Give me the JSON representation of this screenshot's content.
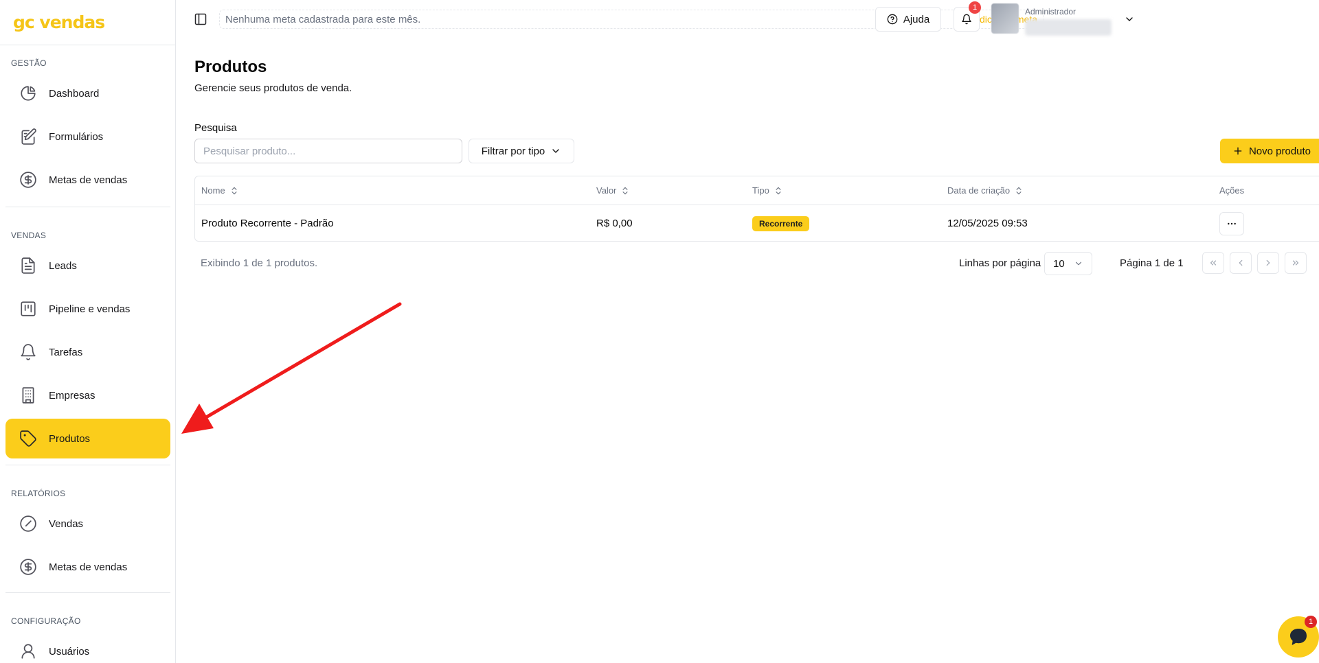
{
  "brand": {
    "logo_text": "gc vendas",
    "accent": "#fbcd1b"
  },
  "sidebar": {
    "groups": [
      {
        "title": "GESTÃO",
        "items": [
          {
            "label": "Dashboard",
            "icon": "pie-chart-icon"
          },
          {
            "label": "Formulários",
            "icon": "form-edit-icon"
          },
          {
            "label": "Metas de vendas",
            "icon": "dollar-circle-icon"
          }
        ]
      },
      {
        "title": "VENDAS",
        "items": [
          {
            "label": "Leads",
            "icon": "document-icon"
          },
          {
            "label": "Pipeline e vendas",
            "icon": "kanban-icon"
          },
          {
            "label": "Tarefas",
            "icon": "bell-icon"
          },
          {
            "label": "Empresas",
            "icon": "building-icon"
          },
          {
            "label": "Produtos",
            "icon": "tag-icon",
            "active": true
          }
        ]
      },
      {
        "title": "RELATÓRIOS",
        "items": [
          {
            "label": "Vendas",
            "icon": "gauge-icon"
          },
          {
            "label": "Metas de vendas",
            "icon": "dollar-circle-icon"
          }
        ]
      },
      {
        "title": "CONFIGURAÇÃO",
        "items": [
          {
            "label": "Usuários",
            "icon": "user-icon"
          }
        ]
      }
    ]
  },
  "header": {
    "meta_message": "Nenhuma meta cadastrada para este mês.",
    "add_meta": "+ Adicionar meta",
    "help": "Ajuda",
    "notifications_count": "1",
    "user_role": "Administrador"
  },
  "main": {
    "title": "Produtos",
    "subtitle": "Gerencie seus produtos de venda.",
    "search_label": "Pesquisa",
    "search_placeholder": "Pesquisar produto...",
    "filter_label": "Filtrar por tipo",
    "new_button": "Novo produto",
    "table": {
      "columns": [
        "Nome",
        "Valor",
        "Tipo",
        "Data de criação",
        "Ações"
      ],
      "rows": [
        {
          "nome": "Produto Recorrente - Padrão",
          "valor": "R$ 0,00",
          "tipo": "Recorrente",
          "data": "12/05/2025 09:53"
        }
      ]
    },
    "footer": {
      "info": "Exibindo 1 de 1 produtos.",
      "rows_per_page_label": "Linhas por página",
      "rows_per_page_value": "10",
      "page_label": "Página 1 de 1"
    }
  },
  "chat": {
    "badge": "1"
  }
}
